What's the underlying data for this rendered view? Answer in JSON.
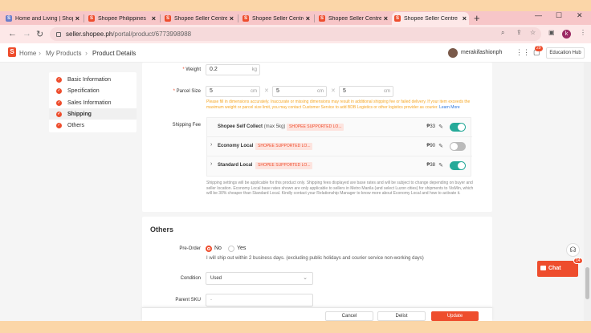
{
  "browser": {
    "tabs": [
      {
        "title": "Home and Living | Shopee",
        "favicon": "S"
      },
      {
        "title": "Shopee Philippines",
        "favicon": "S"
      },
      {
        "title": "Shopee Seller Centre",
        "favicon": "S"
      },
      {
        "title": "Shopee Seller Centre",
        "favicon": "S"
      },
      {
        "title": "Shopee Seller Centre",
        "favicon": "S"
      },
      {
        "title": "Shopee Seller Centre",
        "favicon": "S"
      }
    ],
    "new_tab": "+",
    "url_host": "seller.shopee.ph",
    "url_path": "/portal/product/6773998988",
    "profile_initial": "k"
  },
  "header": {
    "logo": "S",
    "breadcrumb": [
      "Home",
      "My Products",
      "Product Details"
    ],
    "shop_name": "merakifashionph",
    "notif_count": "29",
    "education_hub": "Education Hub"
  },
  "sidebar": {
    "items": [
      {
        "label": "Basic Information"
      },
      {
        "label": "Specification"
      },
      {
        "label": "Sales Information"
      },
      {
        "label": "Shipping"
      },
      {
        "label": "Others"
      }
    ],
    "active_index": 3
  },
  "shipping": {
    "weight_label": "Weight",
    "weight_value": "0.2",
    "weight_unit": "kg",
    "parcel_label": "Parcel Size",
    "parcel": [
      {
        "value": "5",
        "unit": "cm"
      },
      {
        "value": "5",
        "unit": "cm"
      },
      {
        "value": "5",
        "unit": "cm"
      }
    ],
    "parcel_warning": "Please fill in dimensions accurately. Inaccurate or missing dimensions may result in additional shipping fee or failed delivery. If your item exceeds the maximum weight or parcel size limit, you may contact Customer Service to add BDB Logistics or other logistics provider as courier.",
    "learn_more": "Learn More",
    "fee_label": "Shipping Fee",
    "options": [
      {
        "name": "Shopee Self Collect",
        "max": "(max 5kg)",
        "tag": "SHOPEE SUPPORTED LO...",
        "price": "₱33",
        "enabled": true,
        "expandable": false
      },
      {
        "name": "Economy Local",
        "max": "",
        "tag": "SHOPEE SUPPORTED LO...",
        "price": "₱90",
        "enabled": false,
        "expandable": true
      },
      {
        "name": "Standard Local",
        "max": "",
        "tag": "SHOPEE SUPPORTED LO...",
        "price": "₱38",
        "enabled": true,
        "expandable": true
      }
    ],
    "note": "Shipping settings will be applicable for this product only. Shipping fees displayed are base rates and will be subject to change depending on buyer and seller location. Economy Local base rates shown are only applicable to sellers in Metro Manila (and select Luzon cities) for shipments to VisMin, which will be 30% cheaper than Standard Local. Kindly contact your Relationship Manager to know more about Economy Local and how to activate it."
  },
  "others": {
    "title": "Others",
    "preorder_label": "Pre-Order",
    "preorder_no": "No",
    "preorder_yes": "Yes",
    "preorder_selected": "No",
    "ship_text": "I will ship out within 2 business days. (excluding public holidays and courier service non-working days)",
    "condition_label": "Condition",
    "condition_value": "Used",
    "sku_label": "Parent SKU",
    "sku_value": "-"
  },
  "footer": {
    "cancel": "Cancel",
    "delist": "Delist",
    "update": "Update"
  },
  "chat": {
    "label": "Chat",
    "badge": "14"
  },
  "colors": {
    "brand": "#ee4d2d",
    "toggle_on": "#26aa99",
    "warning": "#f5a623",
    "link": "#2673dd"
  }
}
